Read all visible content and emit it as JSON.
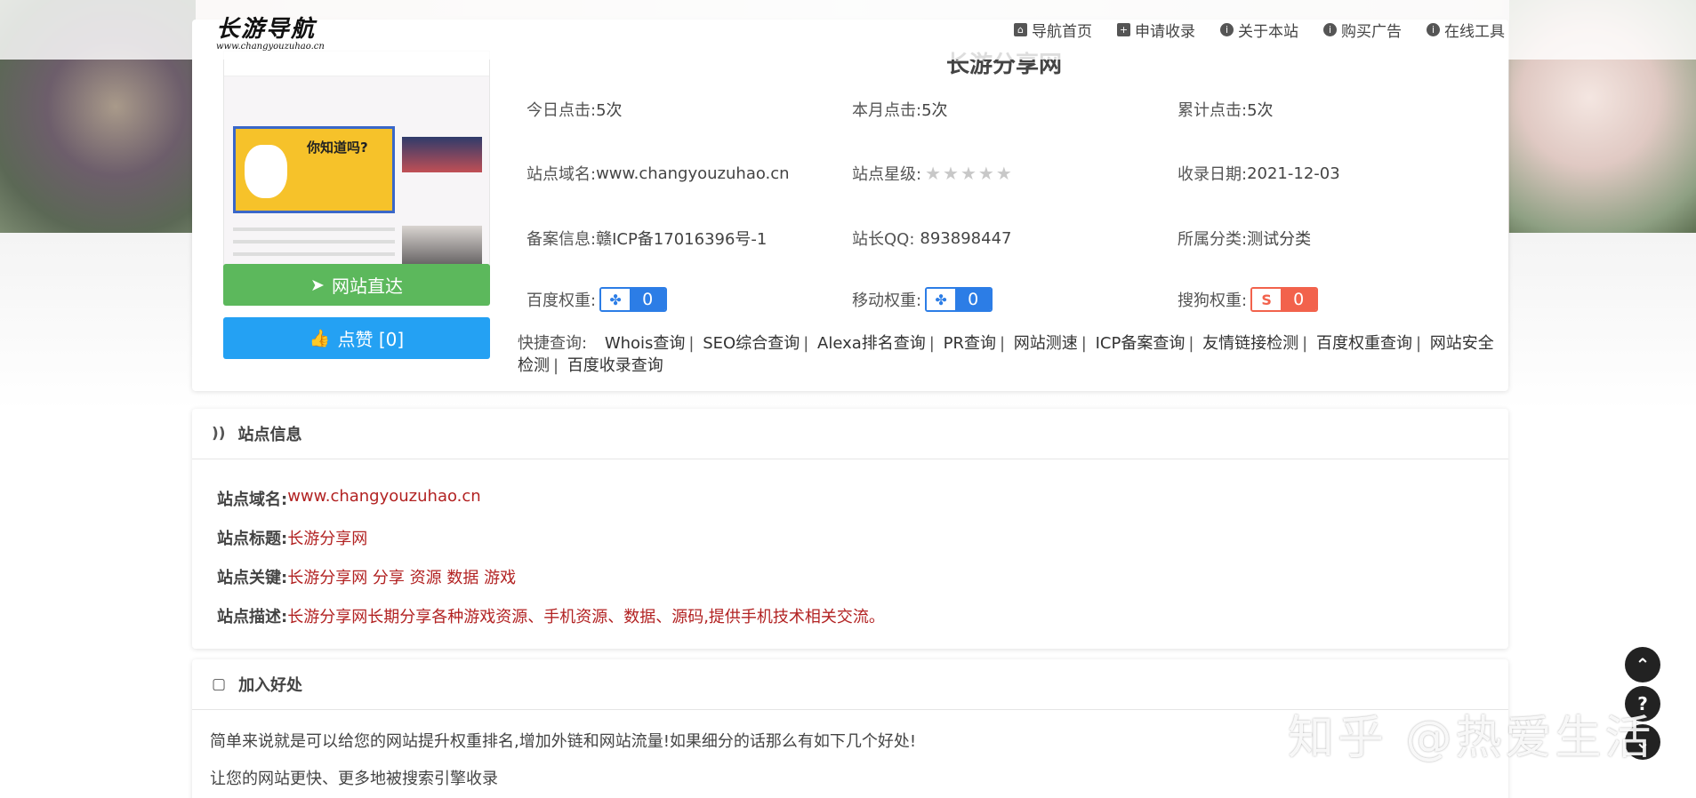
{
  "header": {
    "logo_main": "长游导航",
    "logo_sub": "www.changyouzuhao.cn",
    "nav": [
      {
        "label": "导航首页",
        "icon": "home-icon"
      },
      {
        "label": "申请收录",
        "icon": "plus-square-icon"
      },
      {
        "label": "关于本站",
        "icon": "info-icon"
      },
      {
        "label": "购买广告",
        "icon": "info-icon"
      },
      {
        "label": "在线工具",
        "icon": "info-icon"
      }
    ]
  },
  "site": {
    "title": "长游分享网",
    "thumb_ad_text": "你知道吗?",
    "visit_label": "网站直达",
    "like_label": "点赞 [0]",
    "today_clicks_label": "今日点击:",
    "today_clicks": "5次",
    "month_clicks_label": "本月点击:",
    "month_clicks": "5次",
    "total_clicks_label": "累计点击:",
    "total_clicks": "5次",
    "domain_label": "站点域名:",
    "domain": "www.changyouzuhao.cn",
    "rating_label": "站点星级:",
    "rating": 0,
    "date_label": "收录日期:",
    "date": "2021-12-03",
    "icp_label": "备案信息:",
    "icp": "赣ICP备17016396号-1",
    "qq_label": "站长QQ:",
    "qq": "893898447",
    "category_label": "所属分类:",
    "category": "测试分类",
    "baidu_label": "百度权重:",
    "baidu_value": "0",
    "mobile_label": "移动权重:",
    "mobile_value": "0",
    "sogou_label": "搜狗权重:",
    "sogou_value": "0"
  },
  "quick": {
    "label": "快捷查询:",
    "links": [
      "Whois查询",
      "SEO综合查询",
      "Alexa排名查询",
      "PR查询",
      "网站测速",
      "ICP备案查询",
      "友情链接检测",
      "百度权重查询",
      "网站安全检测",
      "百度收录查询"
    ]
  },
  "siteinfo": {
    "heading": "站点信息",
    "rows": [
      {
        "k": "站点域名:",
        "v": "www.changyouzuhao.cn"
      },
      {
        "k": "站点标题:",
        "v": "长游分享网"
      },
      {
        "k": "站点关键:",
        "v": "长游分享网 分享 资源 数据 游戏"
      },
      {
        "k": "站点描述:",
        "v": "长游分享网长期分享各种游戏资源、手机资源、数据、源码,提供手机技术相关交流。"
      }
    ]
  },
  "benefit": {
    "heading": "加入好处",
    "lines": [
      "简单来说就是可以给您的网站提升权重排名,增加外链和网站流量!如果细分的话那么有如下几个好处!",
      "让您的网站更快、更多地被搜索引擎收录"
    ]
  },
  "watermark": "知乎 @热爱生活"
}
